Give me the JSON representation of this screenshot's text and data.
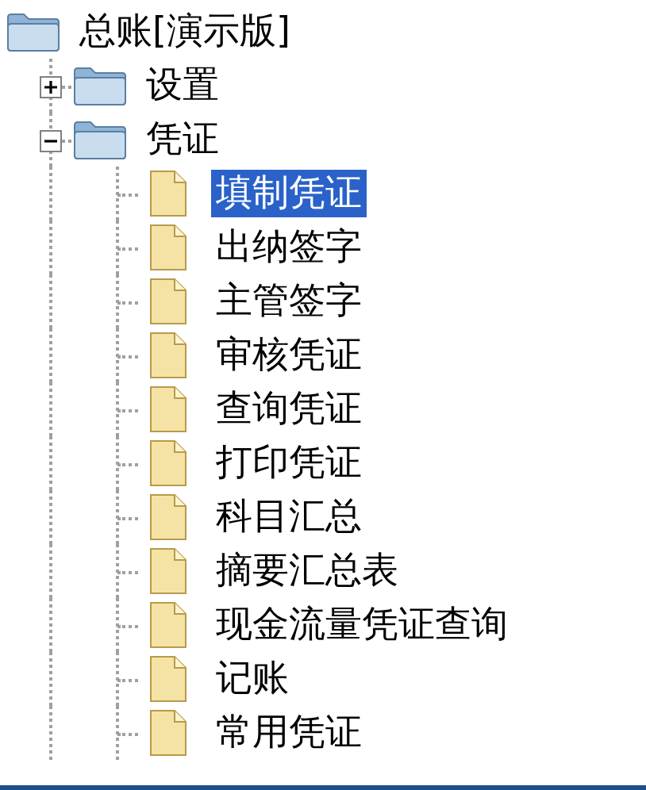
{
  "tree": {
    "label": "总账[演示版]",
    "children": [
      {
        "label": "设置",
        "expanded": false
      },
      {
        "label": "凭证",
        "expanded": true,
        "children": [
          {
            "label": "填制凭证",
            "selected": true
          },
          {
            "label": "出纳签字",
            "selected": false
          },
          {
            "label": "主管签字",
            "selected": false
          },
          {
            "label": "审核凭证",
            "selected": false
          },
          {
            "label": "查询凭证",
            "selected": false
          },
          {
            "label": "打印凭证",
            "selected": false
          },
          {
            "label": "科目汇总",
            "selected": false
          },
          {
            "label": "摘要汇总表",
            "selected": false
          },
          {
            "label": "现金流量凭证查询",
            "selected": false
          },
          {
            "label": "记账",
            "selected": false
          },
          {
            "label": "常用凭证",
            "selected": false
          }
        ]
      }
    ]
  }
}
